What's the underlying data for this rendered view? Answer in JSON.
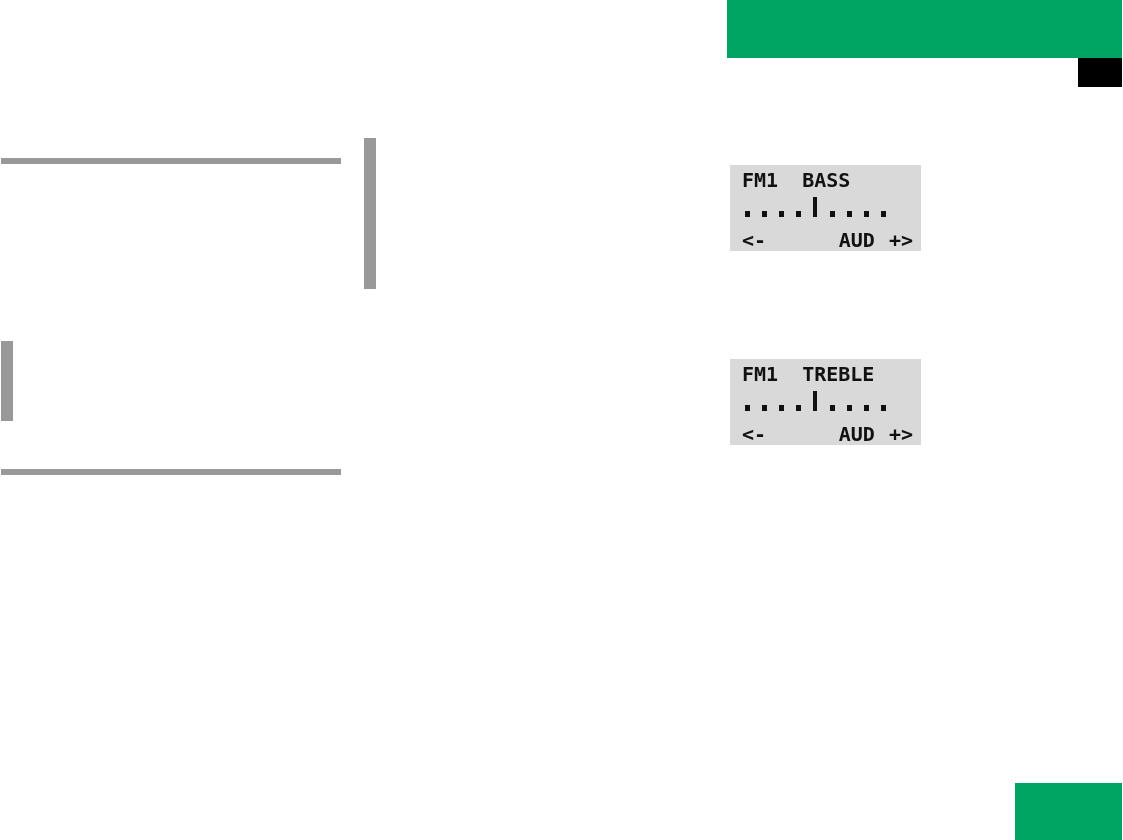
{
  "displays": [
    {
      "band": "FM1",
      "setting": "BASS",
      "level": 0.5,
      "left_key": "<-",
      "mode": "AUD",
      "right_key": "+>"
    },
    {
      "band": "FM1",
      "setting": "TREBLE",
      "level": 0.5,
      "left_key": "<-",
      "mode": "AUD",
      "right_key": "+>"
    }
  ]
}
